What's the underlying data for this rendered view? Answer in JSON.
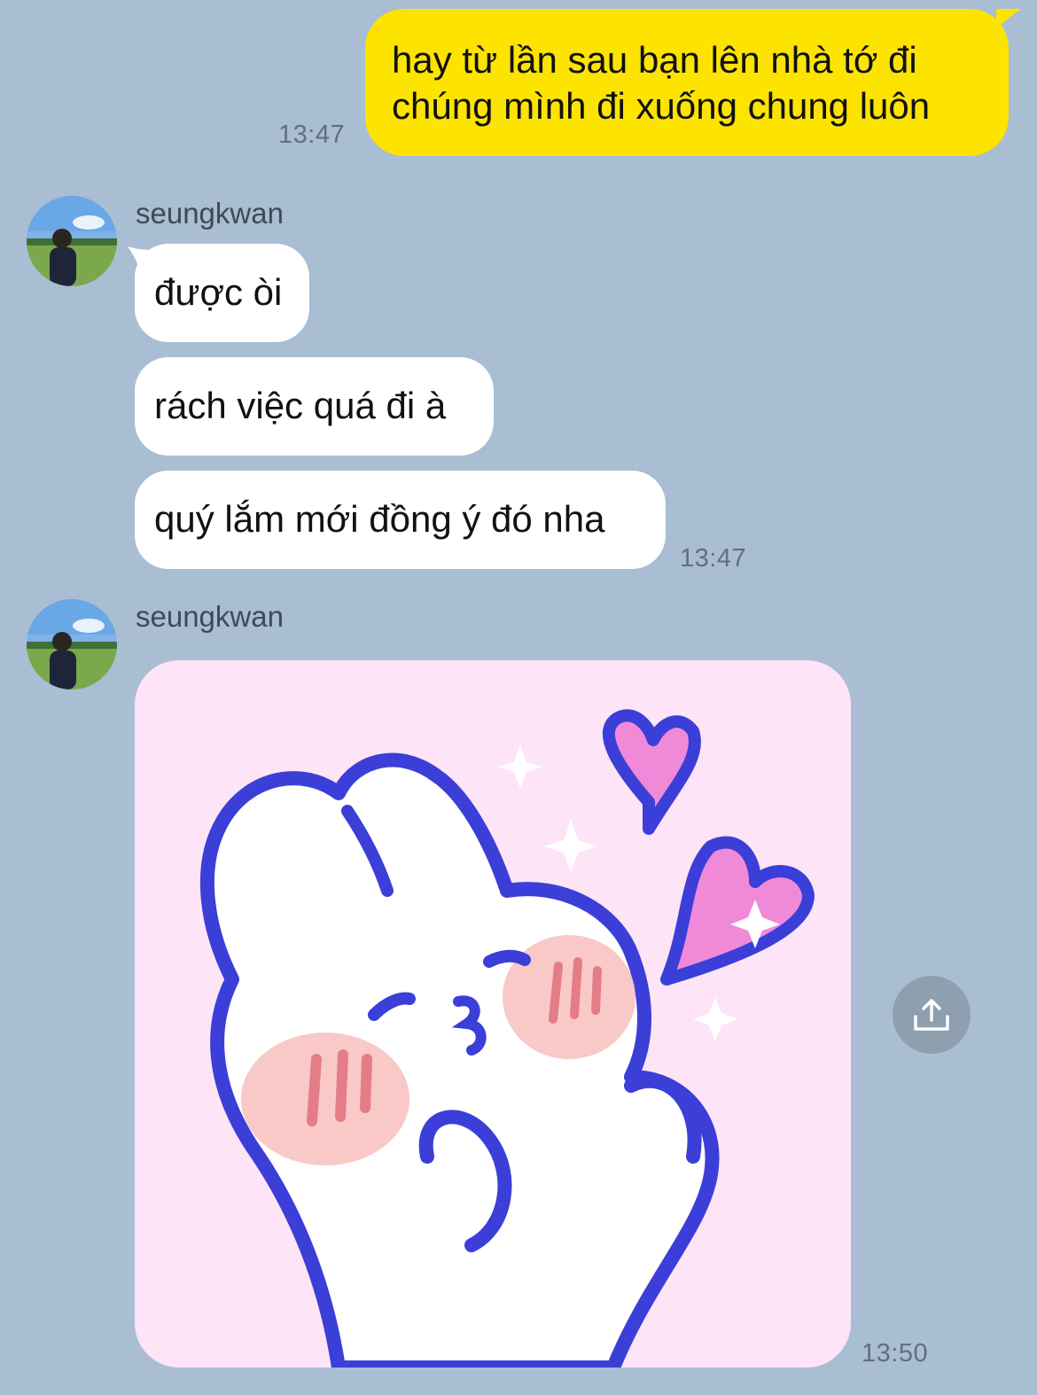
{
  "messages": {
    "sent_1": {
      "line1": "hay từ lần sau bạn lên nhà tớ đi",
      "line2": "chúng mình đi xuống chung luôn",
      "time": "13:47"
    },
    "group_1": {
      "sender": "seungkwan",
      "bubbles": [
        "được òi",
        "rách việc quá đi à",
        "quý lắm mới đồng ý đó nha"
      ],
      "time": "13:47"
    },
    "group_2": {
      "sender": "seungkwan",
      "sticker": "bunny-blowing-kiss-sticker",
      "time": "13:50"
    }
  },
  "colors": {
    "background": "#a9bed3",
    "sent_bubble": "#fce400",
    "received_bubble": "#ffffff",
    "sticker_bg": "#fde4f6"
  },
  "icons": {
    "share": "share-icon"
  }
}
